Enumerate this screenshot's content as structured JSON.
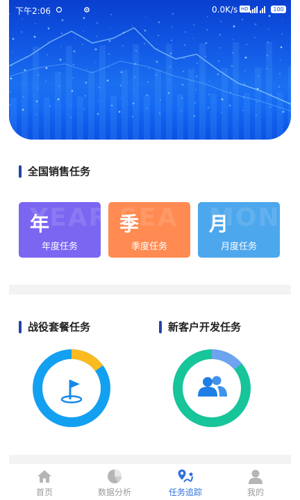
{
  "status_bar": {
    "time": "下午2:06",
    "net_speed": "0.0K/s",
    "hd_badge": "HD",
    "battery": "100"
  },
  "sections": {
    "national_sales": {
      "title": "全国销售任务",
      "cards": [
        {
          "big": "年",
          "label": "年度任务"
        },
        {
          "big": "季",
          "label": "季度任务"
        },
        {
          "big": "月",
          "label": "月度任务"
        }
      ]
    },
    "campaign": {
      "title": "战役套餐任务",
      "progress": 0.15,
      "colors": {
        "primary": "#14a0f0",
        "secondary": "#fbbb1f"
      },
      "icon": "flag-icon"
    },
    "new_customer": {
      "title": "新客户开发任务",
      "progress": 0.14,
      "colors": {
        "primary": "#18c49a",
        "secondary": "#6ea3f0"
      },
      "icon": "users-icon"
    }
  },
  "tabbar": {
    "items": [
      {
        "label": "首页",
        "icon": "home-icon",
        "active": false
      },
      {
        "label": "数据分析",
        "icon": "pie-chart-icon",
        "active": false
      },
      {
        "label": "任务追踪",
        "icon": "map-pin-icon",
        "active": true
      },
      {
        "label": "我的",
        "icon": "user-icon",
        "active": false
      }
    ]
  },
  "colors": {
    "accent": "#2f6fe0",
    "banner": "#0a52e6",
    "card_year": "#7b66f2",
    "card_season": "#ff8b52",
    "card_month": "#4da7ec"
  }
}
